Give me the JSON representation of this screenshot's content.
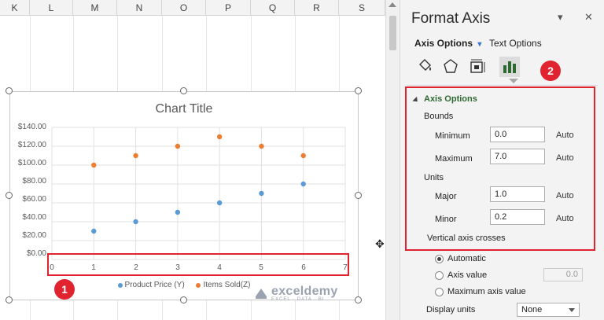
{
  "sheet": {
    "columns": [
      "K",
      "L",
      "M",
      "N",
      "O",
      "P",
      "Q",
      "R",
      "S"
    ]
  },
  "chart": {
    "title": "Chart Title",
    "y_ticks": [
      "$140.00",
      "$120.00",
      "$100.00",
      "$80.00",
      "$60.00",
      "$40.00",
      "$20.00",
      "$0.00"
    ],
    "x_ticks": [
      "0",
      "1",
      "2",
      "3",
      "4",
      "5",
      "6",
      "7"
    ],
    "legend": [
      "Product Price (Y)",
      "Items Sold(Z)"
    ],
    "badge": "1"
  },
  "chart_data": {
    "type": "scatter",
    "title": "Chart Title",
    "xlim": [
      0,
      7
    ],
    "ylim": [
      0,
      140
    ],
    "grid": true,
    "legend_position": "bottom",
    "series": [
      {
        "name": "Product Price (Y)",
        "color": "#5b9bd5",
        "x": [
          1,
          2,
          3,
          4,
          5,
          6
        ],
        "y": [
          30,
          40,
          50,
          60,
          70,
          80
        ]
      },
      {
        "name": "Items Sold(Z)",
        "color": "#ed7d31",
        "x": [
          1,
          2,
          3,
          4,
          5,
          6
        ],
        "y": [
          100,
          110,
          120,
          130,
          120,
          110
        ]
      }
    ]
  },
  "pane": {
    "title": "Format Axis",
    "tabs": {
      "axis_options": "Axis Options",
      "text_options": "Text Options"
    },
    "badge": "2",
    "icons": [
      "fill-line-icon",
      "effects-icon",
      "size-properties-icon",
      "axis-options-icon"
    ],
    "section": "Axis Options",
    "bounds_label": "Bounds",
    "minimum": {
      "label": "Minimum",
      "value": "0.0",
      "auto": "Auto"
    },
    "maximum": {
      "label": "Maximum",
      "value": "7.0",
      "auto": "Auto"
    },
    "units_label": "Units",
    "major": {
      "label": "Major",
      "value": "1.0",
      "auto": "Auto"
    },
    "minor": {
      "label": "Minor",
      "value": "0.2",
      "auto": "Auto"
    },
    "crosses_label": "Vertical axis crosses",
    "crosses_options": {
      "automatic": "Automatic",
      "axis_value": "Axis value",
      "axis_value_input": "0.0",
      "maximum": "Maximum axis value"
    },
    "display_units": {
      "label": "Display units",
      "value": "None"
    }
  },
  "watermark": {
    "name": "exceldemy",
    "tag": "EXCEL · DATA · BI"
  },
  "colors": {
    "accent_red": "#e0232f",
    "section_green": "#2d6a32",
    "series1": "#5b9bd5",
    "series2": "#ed7d31"
  }
}
